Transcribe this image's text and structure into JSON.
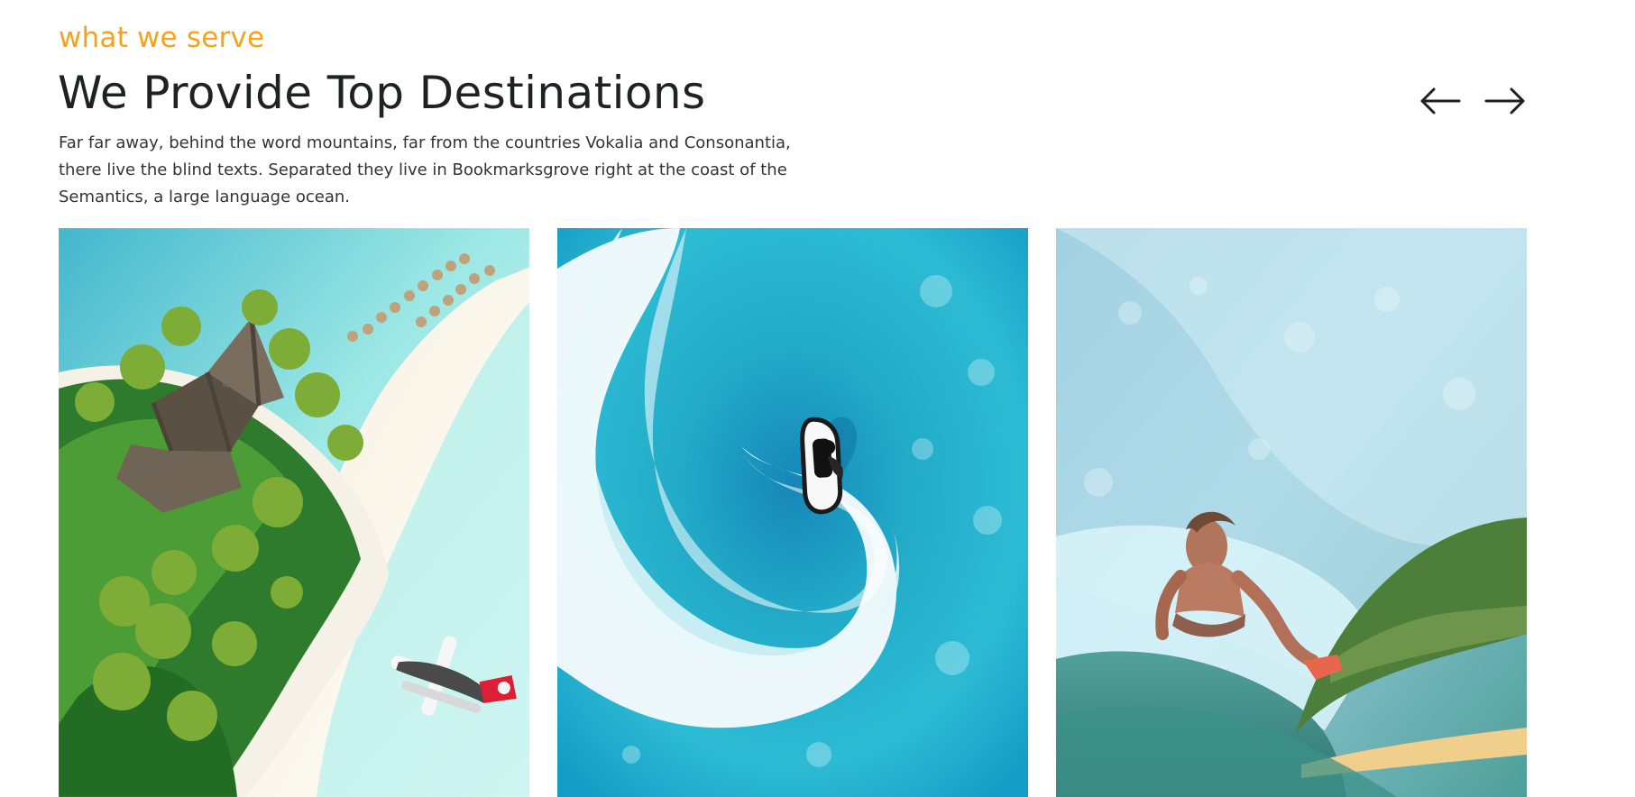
{
  "section": {
    "eyebrow": "what we serve",
    "headline": "We Provide Top Destinations",
    "description": "Far far away, behind the word mountains, far from the countries Vokalia and Consonantia, there live the blind texts. Separated they live in Bookmarksgrove right at the coast of the Semantics, a large language ocean."
  },
  "navigation": {
    "previous_icon": "arrow-left-icon",
    "next_icon": "arrow-right-icon"
  },
  "destinations": [
    {
      "image_name": "tropical-island-image"
    },
    {
      "image_name": "jet-ski-ocean-image"
    },
    {
      "image_name": "surfing-wave-image"
    }
  ],
  "colors": {
    "accent": "#f7a21b",
    "heading": "#1f2124",
    "body": "#333333",
    "background": "#ffffff"
  }
}
